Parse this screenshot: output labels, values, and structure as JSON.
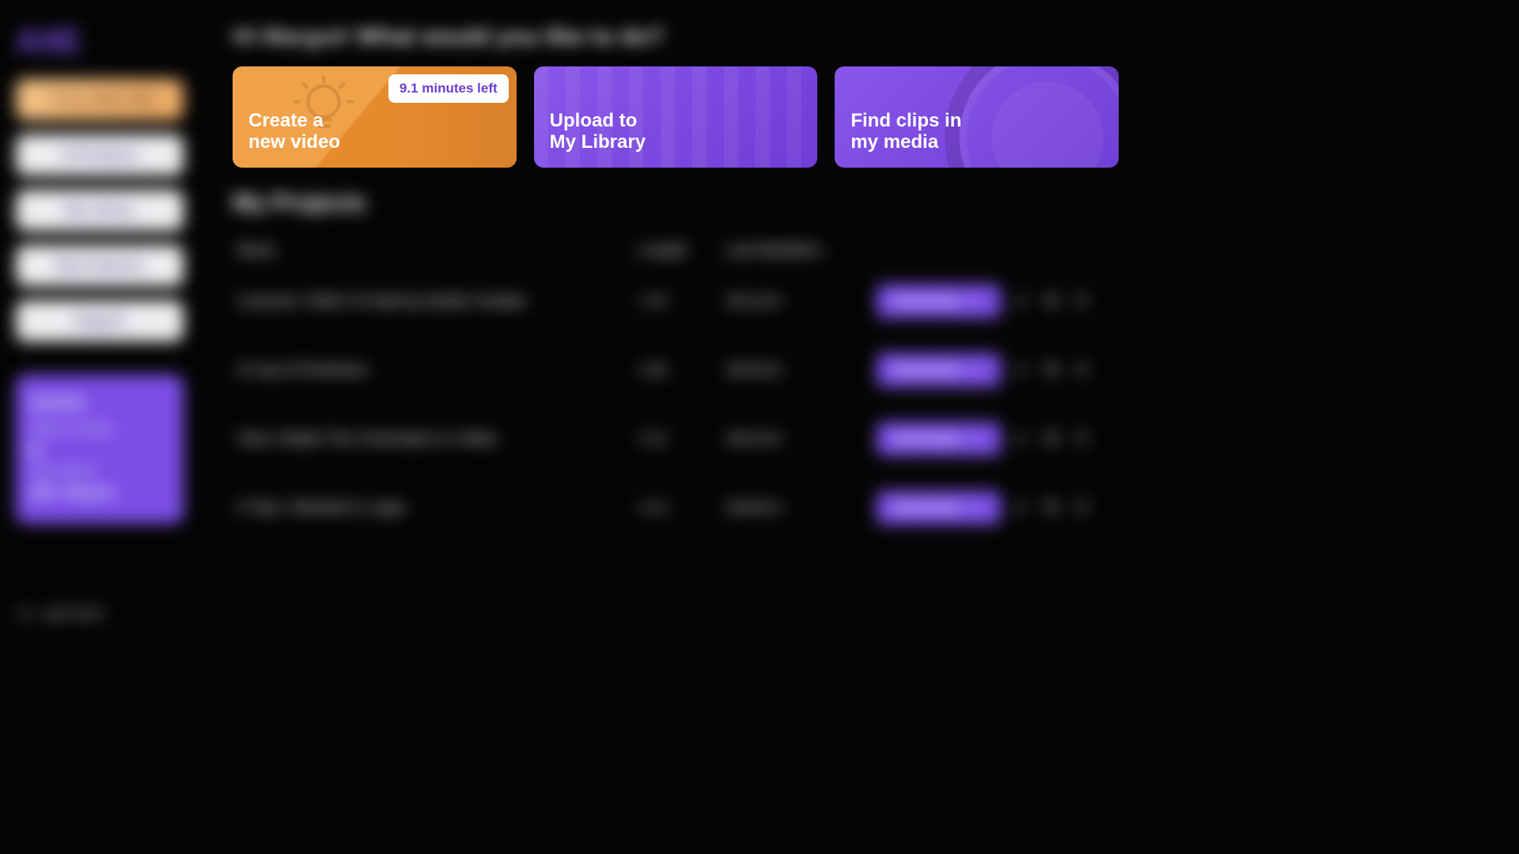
{
  "greeting": {
    "prefix": "Hi Margot!",
    "question": "What would you like to do?"
  },
  "sidebar": {
    "logo": "AXE",
    "nav": [
      {
        "label": "+ Free Video Edit"
      },
      {
        "label": "AI Products"
      },
      {
        "label": "My Library"
      },
      {
        "label": "New Features"
      },
      {
        "label": "Support"
      }
    ],
    "stats": {
      "title": "STATS",
      "line1": "Videos Created:",
      "val1": "8",
      "line2": "Time Saved:",
      "val2": "25+ Hours"
    },
    "theme_label": "Light Mode"
  },
  "cards": {
    "create": {
      "title_l1": "Create a",
      "title_l2": "new video",
      "badge": "9.1 minutes left"
    },
    "upload": {
      "title_l1": "Upload to",
      "title_l2": "My Library"
    },
    "find": {
      "title_l1": "Find clips in",
      "title_l2": "my media"
    }
  },
  "projects": {
    "heading": "My Projects",
    "columns": {
      "name": "Name",
      "length": "Length",
      "modified": "Last Modified ↓"
    },
    "download_label": "Download",
    "rows": [
      {
        "name": "Lessons I Wish I'd Had by Earlier Grades",
        "length": "1:45",
        "modified": "09/14/24"
      },
      {
        "name": "A Cup of Kindness",
        "length": "2:08",
        "modified": "08/30/24"
      },
      {
        "name": "How I Made The Cinematics in Video",
        "length": "3:22",
        "modified": "08/24/24"
      },
      {
        "name": "5 Tips I Wanted in Logic",
        "length": "4:10",
        "modified": "08/06/24"
      }
    ]
  },
  "icons": {
    "bulb": "lightbulb-icon",
    "download": "download-icon",
    "edit": "pencil-icon",
    "copy": "copy-icon",
    "delete": "trash-icon",
    "sun": "sun-icon"
  }
}
